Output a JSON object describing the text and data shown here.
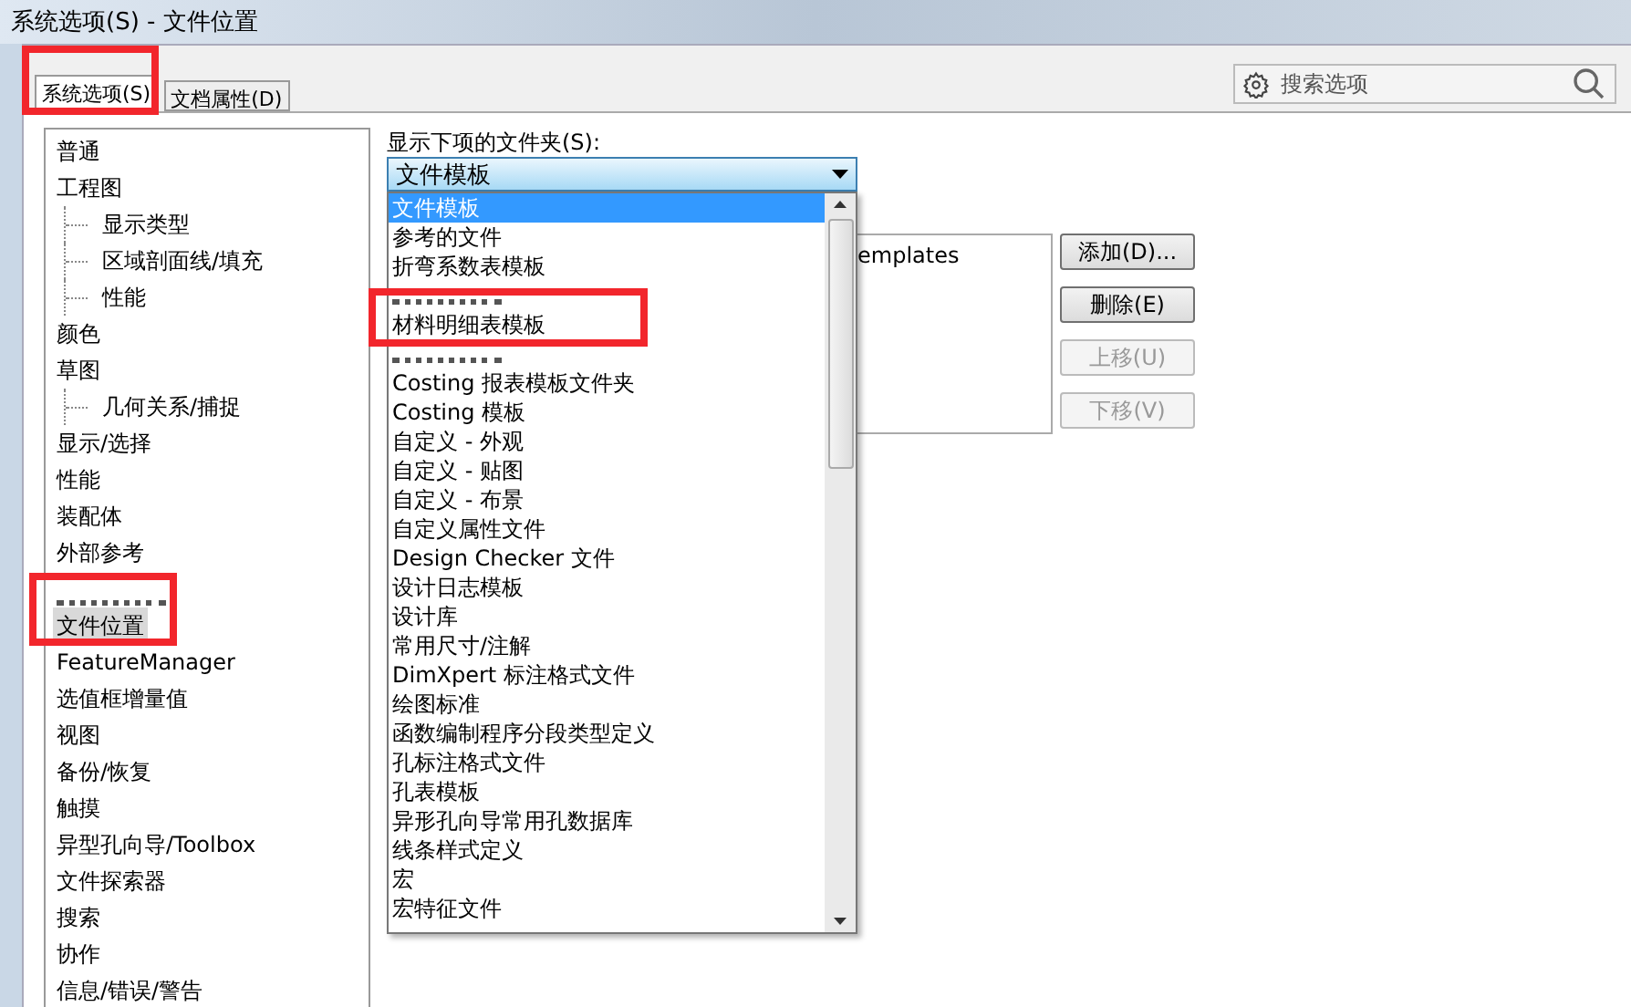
{
  "window": {
    "title": "系统选项(S) - 文件位置"
  },
  "tabs": [
    {
      "label": "系统选项(S)",
      "selected": true
    },
    {
      "label": "文档属性(D)",
      "selected": false
    }
  ],
  "search": {
    "placeholder": "搜索选项"
  },
  "sidebar": {
    "items": [
      {
        "label": "普通",
        "selected": false
      },
      {
        "label": "工程图",
        "selected": false,
        "children": [
          {
            "label": "显示类型",
            "selected": false
          },
          {
            "label": "区域剖面线/填充",
            "selected": false
          },
          {
            "label": "性能",
            "selected": false
          }
        ]
      },
      {
        "label": "颜色",
        "selected": false
      },
      {
        "label": "草图",
        "selected": false,
        "children": [
          {
            "label": "几何关系/捕捉",
            "selected": false
          }
        ]
      },
      {
        "label": "显示/选择",
        "selected": false
      },
      {
        "label": "性能",
        "selected": false
      },
      {
        "label": "装配体",
        "selected": false
      },
      {
        "label": "外部参考",
        "selected": false
      },
      {
        "kind": "obscured"
      },
      {
        "label": "文件位置",
        "selected": true
      },
      {
        "label": "FeatureManager",
        "selected": false
      },
      {
        "label": "选值框增量值",
        "selected": false
      },
      {
        "label": "视图",
        "selected": false
      },
      {
        "label": "备份/恢复",
        "selected": false
      },
      {
        "label": "触摸",
        "selected": false
      },
      {
        "label": "异型孔向导/Toolbox",
        "selected": false
      },
      {
        "label": "文件探索器",
        "selected": false
      },
      {
        "label": "搜索",
        "selected": false
      },
      {
        "label": "协作",
        "selected": false
      },
      {
        "label": "信息/错误/警告",
        "selected": false
      }
    ]
  },
  "folder_label": "显示下项的文件夹(S):",
  "folder_select": {
    "value": "文件模板",
    "options": [
      {
        "label": "文件模板",
        "selected": true
      },
      {
        "label": "参考的文件",
        "selected": false
      },
      {
        "label": "折弯系数表模板",
        "selected": false
      },
      {
        "kind": "obscured"
      },
      {
        "label": "材料明细表模板",
        "selected": false
      },
      {
        "kind": "obscured"
      },
      {
        "label": "Costing 报表模板文件夹",
        "selected": false
      },
      {
        "label": "Costing 模板",
        "selected": false
      },
      {
        "label": "自定义 - 外观",
        "selected": false
      },
      {
        "label": "自定义 - 贴图",
        "selected": false
      },
      {
        "label": "自定义 - 布景",
        "selected": false
      },
      {
        "label": "自定义属性文件",
        "selected": false
      },
      {
        "label": "Design Checker 文件",
        "selected": false
      },
      {
        "label": "设计日志模板",
        "selected": false
      },
      {
        "label": "设计库",
        "selected": false
      },
      {
        "label": "常用尺寸/注解",
        "selected": false
      },
      {
        "label": "DimXpert 标注格式文件",
        "selected": false
      },
      {
        "label": "绘图标准",
        "selected": false
      },
      {
        "label": "函数编制程序分段类型定义",
        "selected": false
      },
      {
        "label": "孔标注格式文件",
        "selected": false
      },
      {
        "label": "孔表模板",
        "selected": false
      },
      {
        "label": "异形孔向导常用孔数据库",
        "selected": false
      },
      {
        "label": "线条样式定义",
        "selected": false
      },
      {
        "label": "宏",
        "selected": false
      },
      {
        "label": "宏特征文件",
        "selected": false
      }
    ]
  },
  "folders": {
    "rows": [
      "emplates"
    ]
  },
  "buttons": [
    {
      "label": "添加(D)...",
      "disabled": false
    },
    {
      "label": "删除(E)",
      "disabled": false
    },
    {
      "label": "上移(U)",
      "disabled": true
    },
    {
      "label": "下移(V)",
      "disabled": true
    }
  ]
}
